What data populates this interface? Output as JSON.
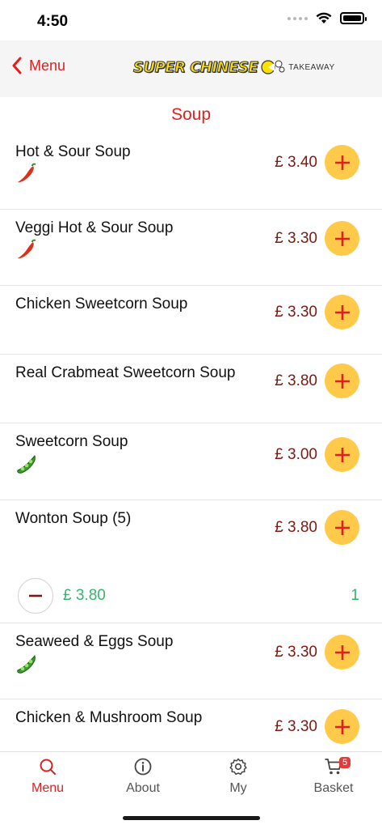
{
  "status": {
    "time": "4:50"
  },
  "nav": {
    "back_label": "Menu",
    "logo_main": "SUPER CHINESE",
    "logo_sub": "TAKEAWAY"
  },
  "section_title": "Soup",
  "items": [
    {
      "name": "Hot & Sour Soup",
      "price": "£ 3.40",
      "icon": "chili-icon"
    },
    {
      "name": "Veggi Hot & Sour Soup",
      "price": "£ 3.30",
      "icon": "chili-icon"
    },
    {
      "name": "Chicken Sweetcorn Soup",
      "price": "£ 3.30",
      "icon": ""
    },
    {
      "name": "Real Crabmeat Sweetcorn Soup",
      "price": "£ 3.80",
      "icon": ""
    },
    {
      "name": "Sweetcorn Soup",
      "price": "£ 3.00",
      "icon": "peas-icon"
    },
    {
      "name": "Wonton Soup (5)",
      "price": "£ 3.80",
      "icon": ""
    },
    {
      "name": "Seaweed & Eggs Soup",
      "price": "£ 3.30",
      "icon": "peas-icon"
    },
    {
      "name": "Chicken & Mushroom Soup",
      "price": "£ 3.30",
      "icon": ""
    }
  ],
  "selection": {
    "price": "£ 3.80",
    "count": "1"
  },
  "tabs": [
    {
      "label": "Menu",
      "icon": "search-icon",
      "active": true
    },
    {
      "label": "About",
      "icon": "info-icon",
      "active": false
    },
    {
      "label": "My",
      "icon": "gear-icon",
      "active": false
    },
    {
      "label": "Basket",
      "icon": "cart-icon",
      "active": false,
      "badge": "5"
    }
  ],
  "colors": {
    "accent": "#e02020",
    "price": "#7a1a12",
    "add_button": "#ffc94a",
    "selection": "#3ab26e"
  }
}
